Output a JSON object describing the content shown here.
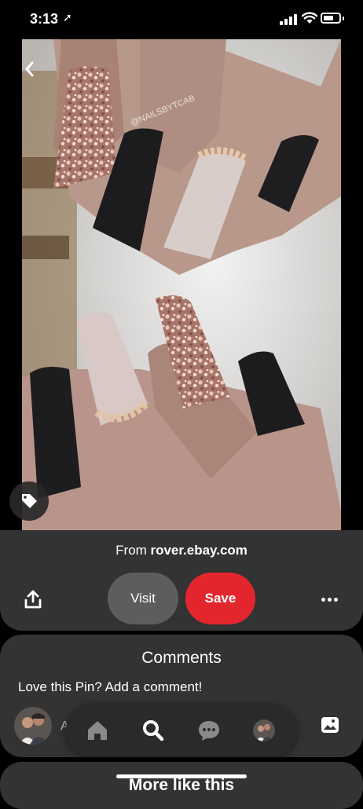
{
  "status_bar": {
    "time": "3:13",
    "location_glyph": "➚"
  },
  "pin": {
    "image_alt": "Coffin nails with black matte, nude with rhinestones, and rose gold glitter",
    "watermark": "@NAILSBYTCAB",
    "source_prefix": "From ",
    "source_domain": "rover.ebay.com"
  },
  "actions": {
    "visit_label": "Visit",
    "save_label": "Save"
  },
  "comments": {
    "title": "Comments",
    "prompt": "Love this Pin? Add a comment!",
    "input_hint": "A"
  },
  "more_like_this": {
    "title": "More like this"
  },
  "colors": {
    "panel": "#333333",
    "save": "#e3262e",
    "visit": "#5d5d5d"
  },
  "icons": [
    "back-icon",
    "tag-icon",
    "share-icon",
    "more-icon",
    "home-icon",
    "search-icon",
    "messages-icon",
    "profile-icon",
    "photo-icon"
  ]
}
